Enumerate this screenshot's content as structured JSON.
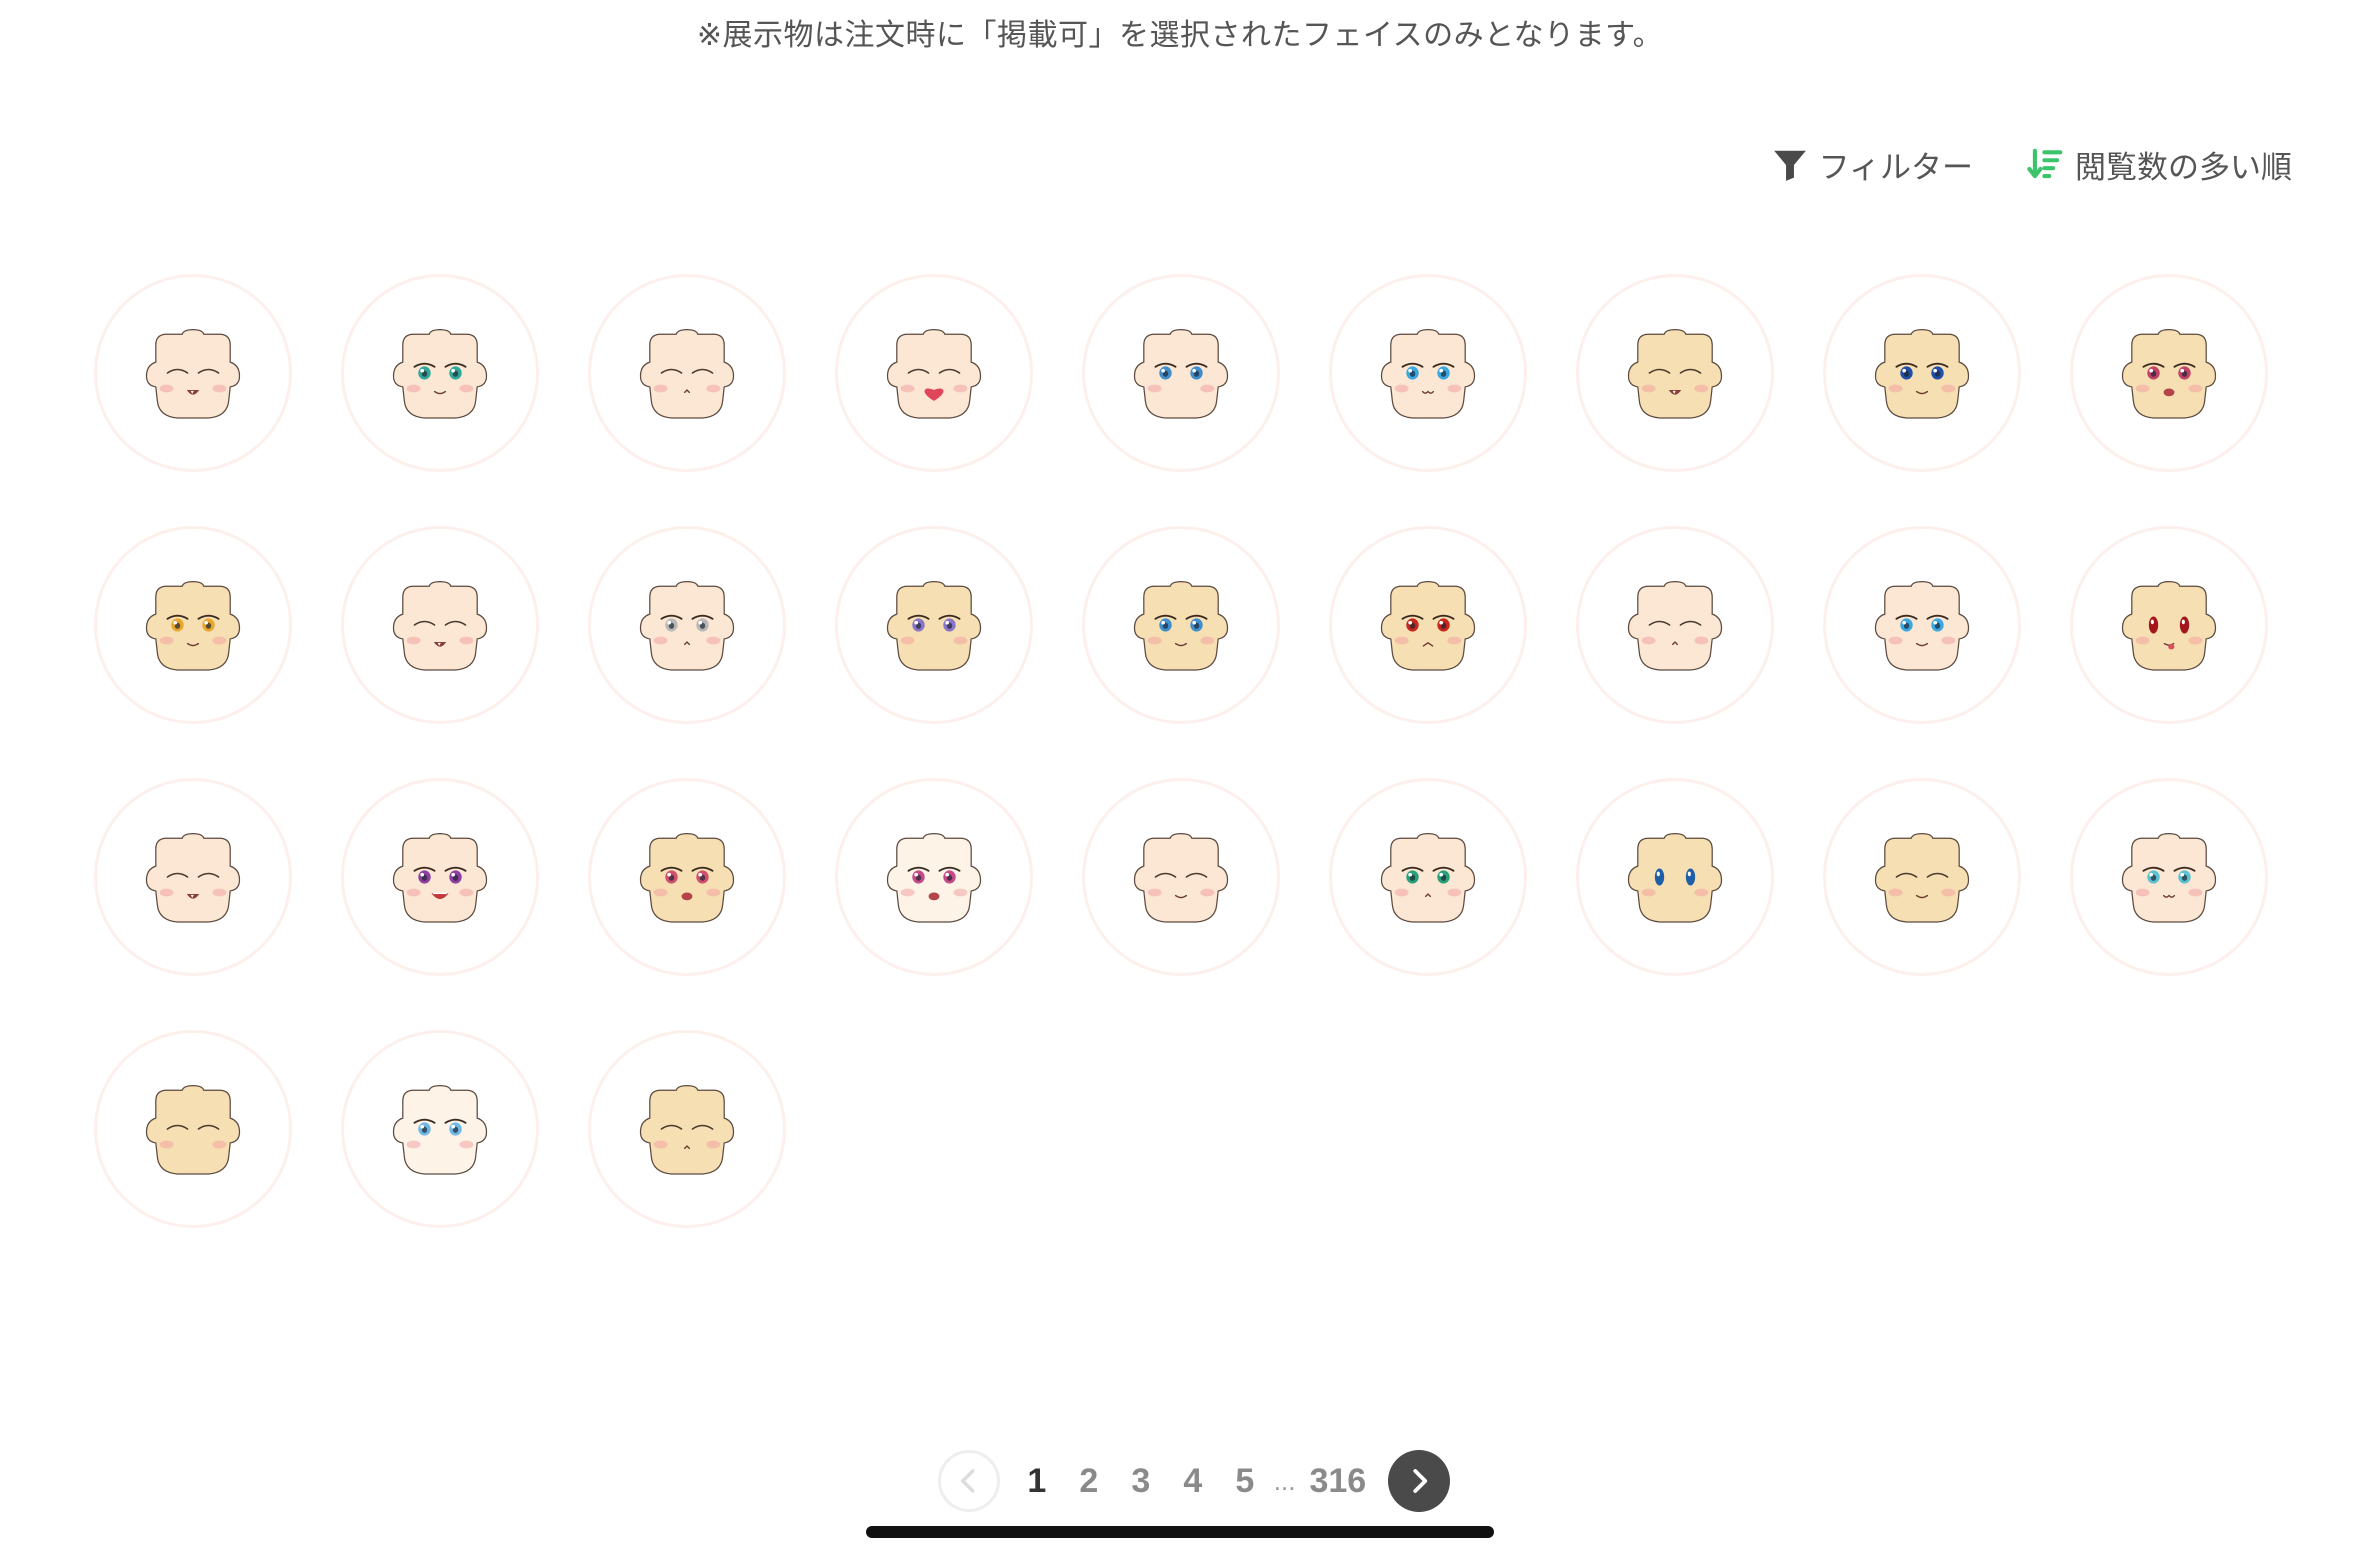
{
  "notice": "※展示物は注文時に「掲載可」を選択されたフェイスのみとなります。",
  "toolbar": {
    "filter_label": "フィルター",
    "sort_label": "閲覧数の多い順"
  },
  "colors": {
    "sort_icon": "#3cc46a",
    "tile_border": "#fdf0ec",
    "next_button": "#4a4a4a"
  },
  "faces": [
    {
      "skin": "#fbe7d3",
      "eyes": "closed",
      "mouth": "fang"
    },
    {
      "skin": "#fbe7d3",
      "eyes": "open",
      "eye_color": "#2fa79b",
      "mouth": "smile"
    },
    {
      "skin": "#fbe7d3",
      "eyes": "closed",
      "mouth": "small"
    },
    {
      "skin": "#fbe7d3",
      "eyes": "closed",
      "mouth": "heart"
    },
    {
      "skin": "#fbe7d3",
      "eyes": "open",
      "eye_color": "#3f8fcf",
      "mouth": "none"
    },
    {
      "skin": "#fbe7d3",
      "eyes": "open",
      "eye_color": "#3aa7e0",
      "mouth": "cat"
    },
    {
      "skin": "#f6dfb2",
      "eyes": "closed",
      "mouth": "fang"
    },
    {
      "skin": "#f6dfb2",
      "eyes": "open",
      "eye_color": "#1f4fa8",
      "mouth": "smile"
    },
    {
      "skin": "#f6dfb2",
      "eyes": "open",
      "eye_color": "#c2426a",
      "mouth": "open"
    },
    {
      "skin": "#f6dfb2",
      "eyes": "open",
      "eye_color": "#e8a72a",
      "mouth": "smile"
    },
    {
      "skin": "#fbe7d3",
      "eyes": "closed",
      "mouth": "fang"
    },
    {
      "skin": "#fbe7d3",
      "eyes": "open",
      "eye_color": "#b8b8b8",
      "mouth": "small"
    },
    {
      "skin": "#f6dfb2",
      "eyes": "open",
      "eye_color": "#8a76c9",
      "mouth": "none"
    },
    {
      "skin": "#f6dfb2",
      "eyes": "open",
      "eye_color": "#3f8fcf",
      "mouth": "smile"
    },
    {
      "skin": "#f6dfb2",
      "eyes": "open",
      "eye_color": "#c7271d",
      "mouth": "frown"
    },
    {
      "skin": "#fbe7d3",
      "eyes": "closed",
      "mouth": "small"
    },
    {
      "skin": "#fbe7d3",
      "eyes": "open",
      "eye_color": "#3aa7e0",
      "mouth": "smile"
    },
    {
      "skin": "#f6dfb2",
      "eyes": "tall",
      "eye_color": "#a3161b",
      "mouth": "tongue"
    },
    {
      "skin": "#fbe7d3",
      "eyes": "closed",
      "mouth": "fang"
    },
    {
      "skin": "#fbe7d3",
      "eyes": "open",
      "eye_color": "#8c3fa0",
      "mouth": "grin"
    },
    {
      "skin": "#f6dfb2",
      "eyes": "open",
      "eye_color": "#d05070",
      "mouth": "open"
    },
    {
      "skin": "#fdf3e6",
      "eyes": "open",
      "eye_color": "#c54b88",
      "mouth": "open"
    },
    {
      "skin": "#fbe7d3",
      "eyes": "closed",
      "mouth": "smile"
    },
    {
      "skin": "#fbe7d3",
      "eyes": "open",
      "eye_color": "#2aa07a",
      "mouth": "small"
    },
    {
      "skin": "#f6dfb2",
      "eyes": "tall",
      "eye_color": "#1f5fa8",
      "mouth": "none"
    },
    {
      "skin": "#f6dfb2",
      "eyes": "closed",
      "mouth": "smile"
    },
    {
      "skin": "#fbe7d3",
      "eyes": "open",
      "eye_color": "#5cc0d0",
      "mouth": "cat"
    },
    {
      "skin": "#f6dfb2",
      "eyes": "closed",
      "mouth": "none"
    },
    {
      "skin": "#fdf3e6",
      "eyes": "open",
      "eye_color": "#6fb8e8",
      "mouth": "none"
    },
    {
      "skin": "#f6dfb2",
      "eyes": "closed",
      "mouth": "small"
    }
  ],
  "pagination": {
    "pages": [
      "1",
      "2",
      "3",
      "4",
      "5"
    ],
    "current": "1",
    "ellipsis": "...",
    "last": "316"
  }
}
